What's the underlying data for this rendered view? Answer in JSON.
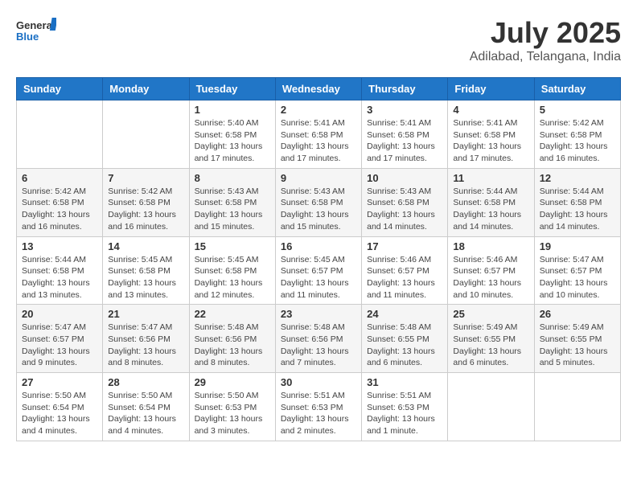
{
  "logo": {
    "general": "General",
    "blue": "Blue"
  },
  "title": {
    "month": "July 2025",
    "location": "Adilabad, Telangana, India"
  },
  "headers": [
    "Sunday",
    "Monday",
    "Tuesday",
    "Wednesday",
    "Thursday",
    "Friday",
    "Saturday"
  ],
  "weeks": [
    [
      {
        "day": "",
        "info": ""
      },
      {
        "day": "",
        "info": ""
      },
      {
        "day": "1",
        "info": "Sunrise: 5:40 AM\nSunset: 6:58 PM\nDaylight: 13 hours and 17 minutes."
      },
      {
        "day": "2",
        "info": "Sunrise: 5:41 AM\nSunset: 6:58 PM\nDaylight: 13 hours and 17 minutes."
      },
      {
        "day": "3",
        "info": "Sunrise: 5:41 AM\nSunset: 6:58 PM\nDaylight: 13 hours and 17 minutes."
      },
      {
        "day": "4",
        "info": "Sunrise: 5:41 AM\nSunset: 6:58 PM\nDaylight: 13 hours and 17 minutes."
      },
      {
        "day": "5",
        "info": "Sunrise: 5:42 AM\nSunset: 6:58 PM\nDaylight: 13 hours and 16 minutes."
      }
    ],
    [
      {
        "day": "6",
        "info": "Sunrise: 5:42 AM\nSunset: 6:58 PM\nDaylight: 13 hours and 16 minutes."
      },
      {
        "day": "7",
        "info": "Sunrise: 5:42 AM\nSunset: 6:58 PM\nDaylight: 13 hours and 16 minutes."
      },
      {
        "day": "8",
        "info": "Sunrise: 5:43 AM\nSunset: 6:58 PM\nDaylight: 13 hours and 15 minutes."
      },
      {
        "day": "9",
        "info": "Sunrise: 5:43 AM\nSunset: 6:58 PM\nDaylight: 13 hours and 15 minutes."
      },
      {
        "day": "10",
        "info": "Sunrise: 5:43 AM\nSunset: 6:58 PM\nDaylight: 13 hours and 14 minutes."
      },
      {
        "day": "11",
        "info": "Sunrise: 5:44 AM\nSunset: 6:58 PM\nDaylight: 13 hours and 14 minutes."
      },
      {
        "day": "12",
        "info": "Sunrise: 5:44 AM\nSunset: 6:58 PM\nDaylight: 13 hours and 14 minutes."
      }
    ],
    [
      {
        "day": "13",
        "info": "Sunrise: 5:44 AM\nSunset: 6:58 PM\nDaylight: 13 hours and 13 minutes."
      },
      {
        "day": "14",
        "info": "Sunrise: 5:45 AM\nSunset: 6:58 PM\nDaylight: 13 hours and 13 minutes."
      },
      {
        "day": "15",
        "info": "Sunrise: 5:45 AM\nSunset: 6:58 PM\nDaylight: 13 hours and 12 minutes."
      },
      {
        "day": "16",
        "info": "Sunrise: 5:45 AM\nSunset: 6:57 PM\nDaylight: 13 hours and 11 minutes."
      },
      {
        "day": "17",
        "info": "Sunrise: 5:46 AM\nSunset: 6:57 PM\nDaylight: 13 hours and 11 minutes."
      },
      {
        "day": "18",
        "info": "Sunrise: 5:46 AM\nSunset: 6:57 PM\nDaylight: 13 hours and 10 minutes."
      },
      {
        "day": "19",
        "info": "Sunrise: 5:47 AM\nSunset: 6:57 PM\nDaylight: 13 hours and 10 minutes."
      }
    ],
    [
      {
        "day": "20",
        "info": "Sunrise: 5:47 AM\nSunset: 6:57 PM\nDaylight: 13 hours and 9 minutes."
      },
      {
        "day": "21",
        "info": "Sunrise: 5:47 AM\nSunset: 6:56 PM\nDaylight: 13 hours and 8 minutes."
      },
      {
        "day": "22",
        "info": "Sunrise: 5:48 AM\nSunset: 6:56 PM\nDaylight: 13 hours and 8 minutes."
      },
      {
        "day": "23",
        "info": "Sunrise: 5:48 AM\nSunset: 6:56 PM\nDaylight: 13 hours and 7 minutes."
      },
      {
        "day": "24",
        "info": "Sunrise: 5:48 AM\nSunset: 6:55 PM\nDaylight: 13 hours and 6 minutes."
      },
      {
        "day": "25",
        "info": "Sunrise: 5:49 AM\nSunset: 6:55 PM\nDaylight: 13 hours and 6 minutes."
      },
      {
        "day": "26",
        "info": "Sunrise: 5:49 AM\nSunset: 6:55 PM\nDaylight: 13 hours and 5 minutes."
      }
    ],
    [
      {
        "day": "27",
        "info": "Sunrise: 5:50 AM\nSunset: 6:54 PM\nDaylight: 13 hours and 4 minutes."
      },
      {
        "day": "28",
        "info": "Sunrise: 5:50 AM\nSunset: 6:54 PM\nDaylight: 13 hours and 4 minutes."
      },
      {
        "day": "29",
        "info": "Sunrise: 5:50 AM\nSunset: 6:53 PM\nDaylight: 13 hours and 3 minutes."
      },
      {
        "day": "30",
        "info": "Sunrise: 5:51 AM\nSunset: 6:53 PM\nDaylight: 13 hours and 2 minutes."
      },
      {
        "day": "31",
        "info": "Sunrise: 5:51 AM\nSunset: 6:53 PM\nDaylight: 13 hours and 1 minute."
      },
      {
        "day": "",
        "info": ""
      },
      {
        "day": "",
        "info": ""
      }
    ]
  ]
}
